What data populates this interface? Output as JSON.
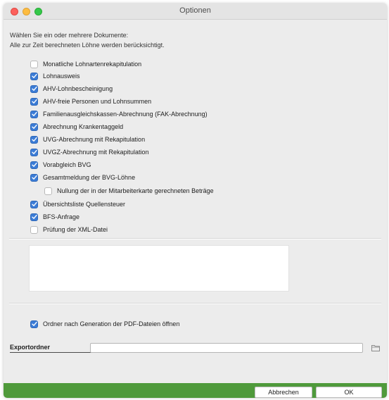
{
  "window": {
    "title": "Optionen"
  },
  "intro": {
    "line1": "Wählen Sie ein oder mehrere Dokumente:",
    "line2": "Alle zur Zeit berechneten Löhne werden berücksichtigt."
  },
  "documents": [
    {
      "label": "Monatliche Lohnartenrekapitulation",
      "checked": false
    },
    {
      "label": "Lohnausweis",
      "checked": true
    },
    {
      "label": "AHV-Lohnbescheinigung",
      "checked": true
    },
    {
      "label": "AHV-freie Personen und Lohnsummen",
      "checked": true
    },
    {
      "label": "Familienausgleichskassen-Abrechnung (FAK-Abrechnung)",
      "checked": true
    },
    {
      "label": "Abrechnung Krankentaggeld",
      "checked": true
    },
    {
      "label": "UVG-Abrechnung mit Rekapitulation",
      "checked": true
    },
    {
      "label": "UVGZ-Abrechnung mit Rekapitulation",
      "checked": true
    },
    {
      "label": "Vorabgleich BVG",
      "checked": true
    },
    {
      "label": "Gesamtmeldung der BVG-Löhne",
      "checked": true
    },
    {
      "label": "Nullung der in der Mitarbeiterkarte gerechneten Beträge",
      "checked": false
    },
    {
      "label": "Übersichtsliste Quellensteuer",
      "checked": true
    },
    {
      "label": "BFS-Anfrage",
      "checked": true
    },
    {
      "label": "Prüfung der XML-Datei",
      "checked": false
    }
  ],
  "open_folder_option": {
    "label": "Ordner nach Generation der PDF-Dateien öffnen",
    "checked": true
  },
  "export": {
    "label": "Exportordner",
    "value": ""
  },
  "buttons": {
    "cancel": "Abbrechen",
    "ok": "OK"
  },
  "colors": {
    "footer": "#4f9a3b",
    "checkbox_checked": "#3b7cd6"
  },
  "icons": {
    "folder": "folder-icon",
    "checkmark": "checkmark-icon"
  }
}
